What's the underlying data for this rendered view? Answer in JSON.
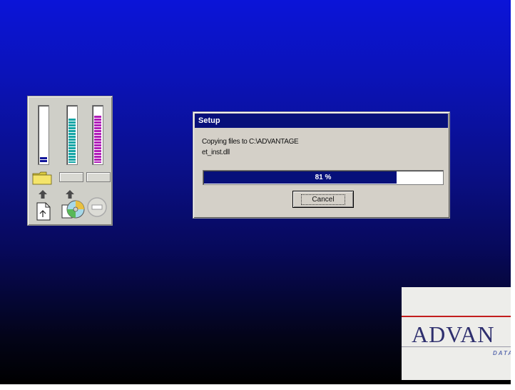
{
  "dialog": {
    "title": "Setup",
    "message_line1": "Copying files to C:\\ADVANTAGE",
    "message_line2": "et_inst.dll",
    "progress_percent": 81,
    "progress_label": "81 %",
    "cancel_label": "Cancel"
  },
  "gauges": {
    "levels": [
      0.15,
      0.8,
      0.85
    ],
    "colors": [
      "#11169a",
      "#14a6a6",
      "#b01cb8"
    ]
  },
  "brand": {
    "name": "ADVAN",
    "sub": "DATA"
  },
  "colors": {
    "desktop_top": "#0b14d8",
    "desktop_bottom": "#000000",
    "titlebar": "#07107a",
    "brand_red": "#c31d1d",
    "brand_navy": "#2e2f6e"
  }
}
